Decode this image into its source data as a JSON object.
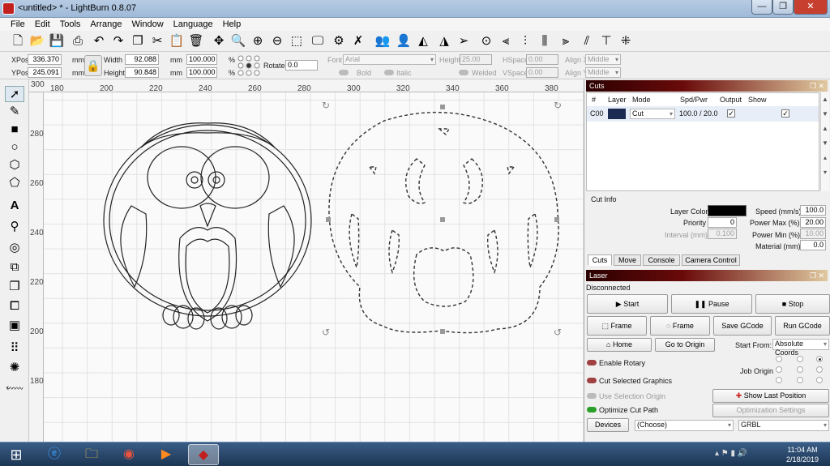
{
  "window": {
    "title": "<untitled> * - LightBurn 0.8.07",
    "minimize": "—",
    "maximize": "❐",
    "close": "✕",
    "close_color": "#c7402f"
  },
  "menus": [
    "File",
    "Edit",
    "Tools",
    "Arrange",
    "Window",
    "Language",
    "Help"
  ],
  "toolbar_icons": [
    "new-file",
    "open-folder",
    "save",
    "export",
    "cut",
    "copy",
    "paste",
    "delete",
    "move",
    "zoom-selection",
    "zoom-in",
    "zoom-out",
    "zoom-frame",
    "monitor",
    "settings-gear",
    "tools",
    "group",
    "person",
    "mirror",
    "send",
    "target",
    "align-left",
    "align-center",
    "align-right",
    "align-top",
    "cross-center"
  ],
  "numeric_edits": {
    "xpos_label": "XPos",
    "xpos": "336.370",
    "ypos_label": "YPos",
    "ypos": "245.091",
    "unit": "mm",
    "width_label": "Width",
    "width": "92.088",
    "height_label": "Height",
    "height": "90.848",
    "scale_w": "100.000",
    "scale_h": "100.000",
    "pct": "%",
    "rotate_label": "Rotate",
    "rotate": "0.0"
  },
  "text_options": {
    "font_label": "Font",
    "font": "Arial",
    "height_label": "Height",
    "height": "25.00",
    "hspace_label": "HSpace",
    "hspace": "0.00",
    "vspace_label": "VSpace",
    "vspace": "0.00",
    "alignx_label": "Align X",
    "alignx": "Middle",
    "aligny_label": "Align Y",
    "aligny": "Middle",
    "bold": "Bold",
    "italic": "Italic",
    "welded": "Welded"
  },
  "ruler": {
    "top": [
      "300",
      "180",
      "200",
      "220",
      "240",
      "260",
      "280",
      "300",
      "320",
      "340",
      "360",
      "380"
    ],
    "left": [
      "280",
      "260",
      "240",
      "220",
      "200",
      "180"
    ]
  },
  "cuts": {
    "title": "Cuts",
    "headers": [
      "#",
      "Layer",
      "Mode",
      "Spd/Pwr",
      "Output",
      "Show"
    ],
    "row": {
      "num": "C00",
      "color": "#1b2b52",
      "mode": "Cut",
      "spdpwr": "100.0 / 20.0",
      "output": "✓",
      "show": "✓"
    }
  },
  "cut_info": {
    "title": "Cut Info",
    "layer_color_label": "Layer Color",
    "layer_color": "#000000",
    "priority_label": "Priority",
    "priority": "0",
    "interval_label": "Interval (mm)",
    "interval": "0.100",
    "speed_label": "Speed (mm/s)",
    "speed": "100.0",
    "power_max_label": "Power Max (%)",
    "power_max": "20.00",
    "power_min_label": "Power Min (%)",
    "power_min": "10.00",
    "material_label": "Material (mm)",
    "material": "0.0"
  },
  "tabs": [
    "Cuts",
    "Move",
    "Console",
    "Camera Control"
  ],
  "laser": {
    "title": "Laser",
    "status": "Disconnected",
    "start": "Start",
    "pause": "Pause",
    "stop": "Stop",
    "frame1": "Frame",
    "frame2": "Frame",
    "save_gcode": "Save GCode",
    "run_gcode": "Run GCode",
    "home": "Home",
    "go_to_origin": "Go to Origin",
    "start_from_label": "Start From:",
    "start_from": "Absolute Coords",
    "job_origin_label": "Job Origin",
    "enable_rotary": "Enable Rotary",
    "cut_selected": "Cut Selected Graphics",
    "use_selection_origin": "Use Selection Origin",
    "optimize_cut_path": "Optimize Cut Path",
    "show_last_position": "Show Last Position",
    "optimization_settings": "Optimization Settings",
    "devices": "Devices",
    "device_select": "(Choose)",
    "controller": "GRBL"
  },
  "taskbar": {
    "time": "11:04 AM",
    "date": "2/18/2019"
  }
}
